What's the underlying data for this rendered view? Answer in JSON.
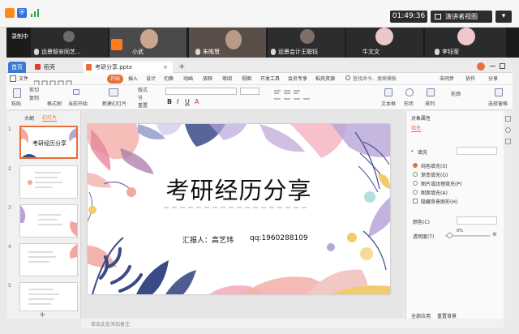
{
  "topbar": {
    "timer": "01:49:36",
    "presenter_view": "演讲者视图",
    "more": "▾"
  },
  "meeting": {
    "status": "录制中",
    "participants": [
      "远景智安同艺...",
      "小武",
      "朱皓慧",
      "远景会计王聪钰",
      "牛文文",
      "李钰莹"
    ]
  },
  "tabs": {
    "home": "首页",
    "docer": "稻壳",
    "file": "考研分享.pptx",
    "add": "+"
  },
  "menu": {
    "items": [
      "文件",
      "开始",
      "插入",
      "设计",
      "切换",
      "动画",
      "放映",
      "审阅",
      "视图",
      "开发工具",
      "会员专享",
      "稻壳资源"
    ],
    "search_placeholder": "查找命令、搜索模板",
    "right": [
      "未同步",
      "协作",
      "分享"
    ]
  },
  "ribbon": {
    "items": [
      "粘贴",
      "剪切",
      "复制",
      "格式刷",
      "当前开始",
      "新建幻灯片",
      "版式",
      "节",
      "重置",
      "文本框",
      "形状",
      "排列",
      "轮廓",
      "选择窗格"
    ]
  },
  "leftpane": {
    "tab_outline": "大纲",
    "tab_slides": "幻灯片",
    "slide_numbers": [
      "1",
      "2",
      "3",
      "4",
      "5"
    ],
    "add": "+"
  },
  "slide": {
    "title": "考研经历分享",
    "reporter": "汇报人：高艺玮",
    "qq": "qq:1960288109"
  },
  "statusbar": {
    "note": "单击此处添加备注"
  },
  "rightpane": {
    "title": "对象属性",
    "tab_fill": "填充",
    "section": "填充",
    "options": [
      "纯色填充(S)",
      "渐变填充(G)",
      "图片或纹理填充(P)",
      "图案填充(A)",
      "隐藏背景图形(H)"
    ],
    "color_label": "颜色(C)",
    "transparency_label": "透明度(T)",
    "transparency_value": "0%",
    "apply_all": "全部应用",
    "reset_bg": "重置背景"
  },
  "colors": {
    "accent_orange": "#e76f3a",
    "wps_red": "#d83a2f",
    "slide_pink": "#f2a7a0",
    "slide_navy": "#3b4a86",
    "slide_lilac": "#b7a5d8"
  }
}
